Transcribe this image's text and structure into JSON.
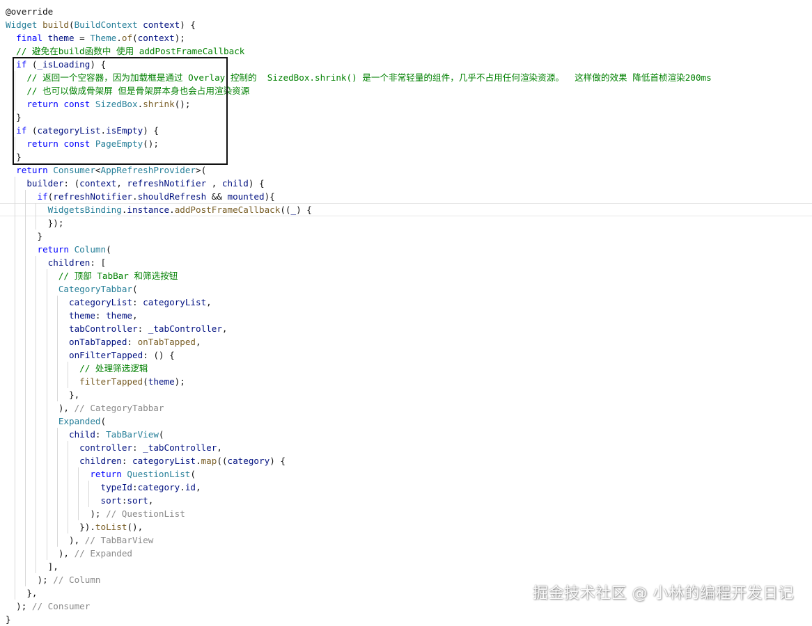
{
  "editor": {
    "language": "dart",
    "highlight_note": "box around the first two if-blocks",
    "lines": [
      [
        [
          "plain",
          "@override"
        ]
      ],
      [
        [
          "ty",
          "Widget "
        ],
        [
          "fn",
          "build"
        ],
        [
          "plain",
          "("
        ],
        [
          "ty",
          "BuildContext "
        ],
        [
          "id",
          "context"
        ],
        [
          "plain",
          ") {"
        ]
      ],
      [
        [
          "plain",
          "  "
        ],
        [
          "kw",
          "final "
        ],
        [
          "id",
          "theme "
        ],
        [
          "plain",
          "= "
        ],
        [
          "ty",
          "Theme"
        ],
        [
          "plain",
          "."
        ],
        [
          "fn",
          "of"
        ],
        [
          "plain",
          "("
        ],
        [
          "id",
          "context"
        ],
        [
          "plain",
          ");"
        ]
      ],
      [
        [
          "plain",
          "  "
        ],
        [
          "cm",
          "// 避免在build函数中 使用 addPostFrameCallback"
        ]
      ],
      [
        [
          "plain",
          "  "
        ],
        [
          "kw",
          "if "
        ],
        [
          "plain",
          "("
        ],
        [
          "id",
          "_isLoading"
        ],
        [
          "plain",
          ") {"
        ]
      ],
      [
        [
          "plain",
          "    "
        ],
        [
          "cm",
          "// 返回一个空容器，因为加载框是通过 Overlay 控制的  SizedBox.shrink() 是一个非常轻量的组件，几乎不占用任何渲染资源。  这样做的效果 降低首桢渲染200ms"
        ]
      ],
      [
        [
          "plain",
          "    "
        ],
        [
          "cm",
          "// 也可以做成骨架屏 但是骨架屏本身也会占用渲染资源"
        ]
      ],
      [
        [
          "plain",
          "    "
        ],
        [
          "kw",
          "return const "
        ],
        [
          "ty",
          "SizedBox"
        ],
        [
          "plain",
          "."
        ],
        [
          "fn",
          "shrink"
        ],
        [
          "plain",
          "();"
        ]
      ],
      [
        [
          "plain",
          "  }"
        ]
      ],
      [
        [
          "plain",
          "  "
        ],
        [
          "kw",
          "if "
        ],
        [
          "plain",
          "("
        ],
        [
          "id",
          "categoryList"
        ],
        [
          "plain",
          "."
        ],
        [
          "id",
          "isEmpty"
        ],
        [
          "plain",
          ") {"
        ]
      ],
      [
        [
          "plain",
          "    "
        ],
        [
          "kw",
          "return const "
        ],
        [
          "ty",
          "PageEmpty"
        ],
        [
          "plain",
          "();"
        ]
      ],
      [
        [
          "plain",
          "  }"
        ]
      ],
      [
        [
          "plain",
          "  "
        ],
        [
          "kw",
          "return "
        ],
        [
          "ty",
          "Consumer"
        ],
        [
          "plain",
          "<"
        ],
        [
          "ty",
          "AppRefreshProvider"
        ],
        [
          "plain",
          ">("
        ]
      ],
      [
        [
          "plain",
          "    "
        ],
        [
          "id",
          "builder"
        ],
        [
          "plain",
          ": ("
        ],
        [
          "id",
          "context"
        ],
        [
          "plain",
          ", "
        ],
        [
          "id",
          "refreshNotifier "
        ],
        [
          "plain",
          ", "
        ],
        [
          "id",
          "child"
        ],
        [
          "plain",
          ") {"
        ]
      ],
      [
        [
          "plain",
          "      "
        ],
        [
          "kw",
          "if"
        ],
        [
          "plain",
          "("
        ],
        [
          "id",
          "refreshNotifier"
        ],
        [
          "plain",
          "."
        ],
        [
          "id",
          "shouldRefresh "
        ],
        [
          "plain",
          "&& "
        ],
        [
          "id",
          "mounted"
        ],
        [
          "plain",
          "){"
        ]
      ],
      [
        [
          "plain",
          "        "
        ],
        [
          "ty",
          "WidgetsBinding"
        ],
        [
          "plain",
          "."
        ],
        [
          "id",
          "instance"
        ],
        [
          "plain",
          "."
        ],
        [
          "fn",
          "addPostFrameCallback"
        ],
        [
          "plain",
          "(("
        ],
        [
          "id",
          "_"
        ],
        [
          "plain",
          ") {"
        ]
      ],
      [
        [
          "plain",
          "        "
        ],
        [
          "plain",
          "});"
        ]
      ],
      [
        [
          "plain",
          "      }"
        ]
      ],
      [
        [
          "plain",
          "      "
        ],
        [
          "kw",
          "return "
        ],
        [
          "ty",
          "Column"
        ],
        [
          "plain",
          "("
        ]
      ],
      [
        [
          "plain",
          "        "
        ],
        [
          "id",
          "children"
        ],
        [
          "plain",
          ": ["
        ]
      ],
      [
        [
          "plain",
          "          "
        ],
        [
          "cm",
          "// 顶部 TabBar 和筛选按钮"
        ]
      ],
      [
        [
          "plain",
          "          "
        ],
        [
          "ty",
          "CategoryTabbar"
        ],
        [
          "plain",
          "("
        ]
      ],
      [
        [
          "plain",
          "            "
        ],
        [
          "id",
          "categoryList"
        ],
        [
          "plain",
          ": "
        ],
        [
          "id",
          "categoryList"
        ],
        [
          "plain",
          ","
        ]
      ],
      [
        [
          "plain",
          "            "
        ],
        [
          "id",
          "theme"
        ],
        [
          "plain",
          ": "
        ],
        [
          "id",
          "theme"
        ],
        [
          "plain",
          ","
        ]
      ],
      [
        [
          "plain",
          "            "
        ],
        [
          "id",
          "tabController"
        ],
        [
          "plain",
          ": "
        ],
        [
          "id",
          "_tabController"
        ],
        [
          "plain",
          ","
        ]
      ],
      [
        [
          "plain",
          "            "
        ],
        [
          "id",
          "onTabTapped"
        ],
        [
          "plain",
          ": "
        ],
        [
          "fn",
          "onTabTapped"
        ],
        [
          "plain",
          ","
        ]
      ],
      [
        [
          "plain",
          "            "
        ],
        [
          "id",
          "onFilterTapped"
        ],
        [
          "plain",
          ": () {"
        ]
      ],
      [
        [
          "plain",
          "              "
        ],
        [
          "cm",
          "// 处理筛选逻辑"
        ]
      ],
      [
        [
          "plain",
          "              "
        ],
        [
          "fn",
          "filterTapped"
        ],
        [
          "plain",
          "("
        ],
        [
          "id",
          "theme"
        ],
        [
          "plain",
          ");"
        ]
      ],
      [
        [
          "plain",
          "            },"
        ]
      ],
      [
        [
          "plain",
          "          ), "
        ],
        [
          "gc",
          "// CategoryTabbar"
        ]
      ],
      [
        [
          "plain",
          "          "
        ],
        [
          "ty",
          "Expanded"
        ],
        [
          "plain",
          "("
        ]
      ],
      [
        [
          "plain",
          "            "
        ],
        [
          "id",
          "child"
        ],
        [
          "plain",
          ": "
        ],
        [
          "ty",
          "TabBarView"
        ],
        [
          "plain",
          "("
        ]
      ],
      [
        [
          "plain",
          "              "
        ],
        [
          "id",
          "controller"
        ],
        [
          "plain",
          ": "
        ],
        [
          "id",
          "_tabController"
        ],
        [
          "plain",
          ","
        ]
      ],
      [
        [
          "plain",
          "              "
        ],
        [
          "id",
          "children"
        ],
        [
          "plain",
          ": "
        ],
        [
          "id",
          "categoryList"
        ],
        [
          "plain",
          "."
        ],
        [
          "fn",
          "map"
        ],
        [
          "plain",
          "(("
        ],
        [
          "id",
          "category"
        ],
        [
          "plain",
          ") {"
        ]
      ],
      [
        [
          "plain",
          "                "
        ],
        [
          "kw",
          "return "
        ],
        [
          "ty",
          "QuestionList"
        ],
        [
          "plain",
          "("
        ]
      ],
      [
        [
          "plain",
          "                  "
        ],
        [
          "id",
          "typeId"
        ],
        [
          "plain",
          ":"
        ],
        [
          "id",
          "category"
        ],
        [
          "plain",
          "."
        ],
        [
          "id",
          "id"
        ],
        [
          "plain",
          ","
        ]
      ],
      [
        [
          "plain",
          "                  "
        ],
        [
          "id",
          "sort"
        ],
        [
          "plain",
          ":"
        ],
        [
          "id",
          "sort"
        ],
        [
          "plain",
          ","
        ]
      ],
      [
        [
          "plain",
          "                ); "
        ],
        [
          "gc",
          "// QuestionList"
        ]
      ],
      [
        [
          "plain",
          "              })."
        ],
        [
          "fn",
          "toList"
        ],
        [
          "plain",
          "(),"
        ]
      ],
      [
        [
          "plain",
          "            ), "
        ],
        [
          "gc",
          "// TabBarView"
        ]
      ],
      [
        [
          "plain",
          "          ), "
        ],
        [
          "gc",
          "// Expanded"
        ]
      ],
      [
        [
          "plain",
          "        ],"
        ]
      ],
      [
        [
          "plain",
          "      ); "
        ],
        [
          "gc",
          "// Column"
        ]
      ],
      [
        [
          "plain",
          "    },"
        ]
      ],
      [
        [
          "plain",
          "  ); "
        ],
        [
          "gc",
          "// Consumer"
        ]
      ],
      [
        [
          "plain",
          "}"
        ]
      ]
    ]
  },
  "watermark": {
    "text": "掘金技术社区 @ 小林的编程开发日记"
  }
}
